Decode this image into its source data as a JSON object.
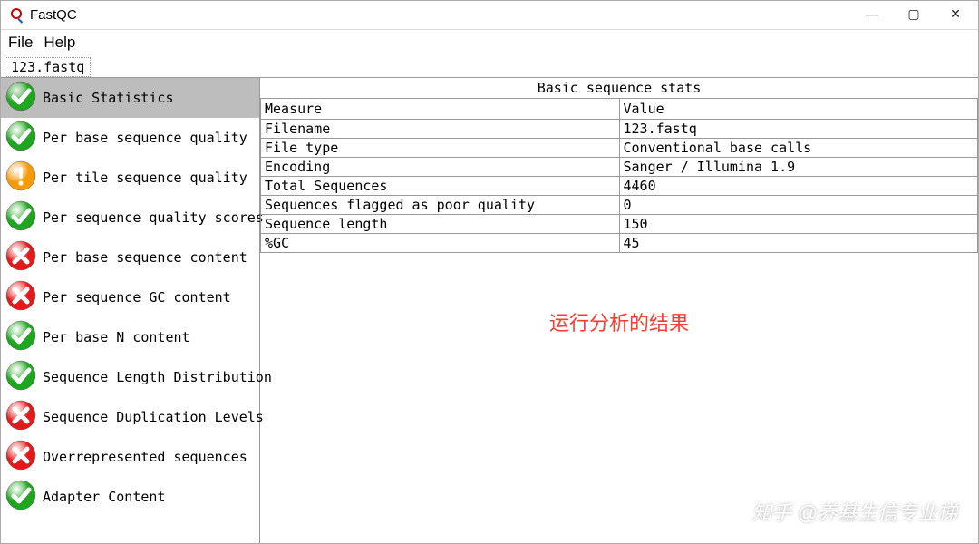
{
  "window": {
    "title": "FastQC",
    "controls": {
      "minimize": "—",
      "maximize": "▢",
      "close": "✕"
    }
  },
  "menubar": [
    "File",
    "Help"
  ],
  "tabs": [
    {
      "label": "123.fastq",
      "active": true
    }
  ],
  "sidebar": {
    "items": [
      {
        "label": "Basic Statistics",
        "status": "pass",
        "selected": true
      },
      {
        "label": "Per base sequence quality",
        "status": "pass",
        "selected": false
      },
      {
        "label": "Per tile sequence quality",
        "status": "warn",
        "selected": false
      },
      {
        "label": "Per sequence quality scores",
        "status": "pass",
        "selected": false
      },
      {
        "label": "Per base sequence content",
        "status": "fail",
        "selected": false
      },
      {
        "label": "Per sequence GC content",
        "status": "fail",
        "selected": false
      },
      {
        "label": "Per base N content",
        "status": "pass",
        "selected": false
      },
      {
        "label": "Sequence Length Distribution",
        "status": "pass",
        "selected": false
      },
      {
        "label": "Sequence Duplication Levels",
        "status": "fail",
        "selected": false
      },
      {
        "label": "Overrepresented sequences",
        "status": "fail",
        "selected": false
      },
      {
        "label": "Adapter Content",
        "status": "pass",
        "selected": false
      }
    ]
  },
  "panel": {
    "title": "Basic sequence stats",
    "headers": [
      "Measure",
      "Value"
    ],
    "rows": [
      {
        "measure": "Filename",
        "value": "123.fastq"
      },
      {
        "measure": "File type",
        "value": "Conventional base calls"
      },
      {
        "measure": "Encoding",
        "value": "Sanger / Illumina 1.9"
      },
      {
        "measure": "Total Sequences",
        "value": "4460"
      },
      {
        "measure": "Sequences flagged as poor quality",
        "value": "0"
      },
      {
        "measure": "Sequence length",
        "value": "150"
      },
      {
        "measure": "%GC",
        "value": "45"
      }
    ]
  },
  "annotation": "运行分析的结果",
  "watermark": "知乎 @养基生信专业梯",
  "colors": {
    "pass": "#1fa51f",
    "warn": "#f59a0b",
    "fail": "#e21a1a"
  }
}
